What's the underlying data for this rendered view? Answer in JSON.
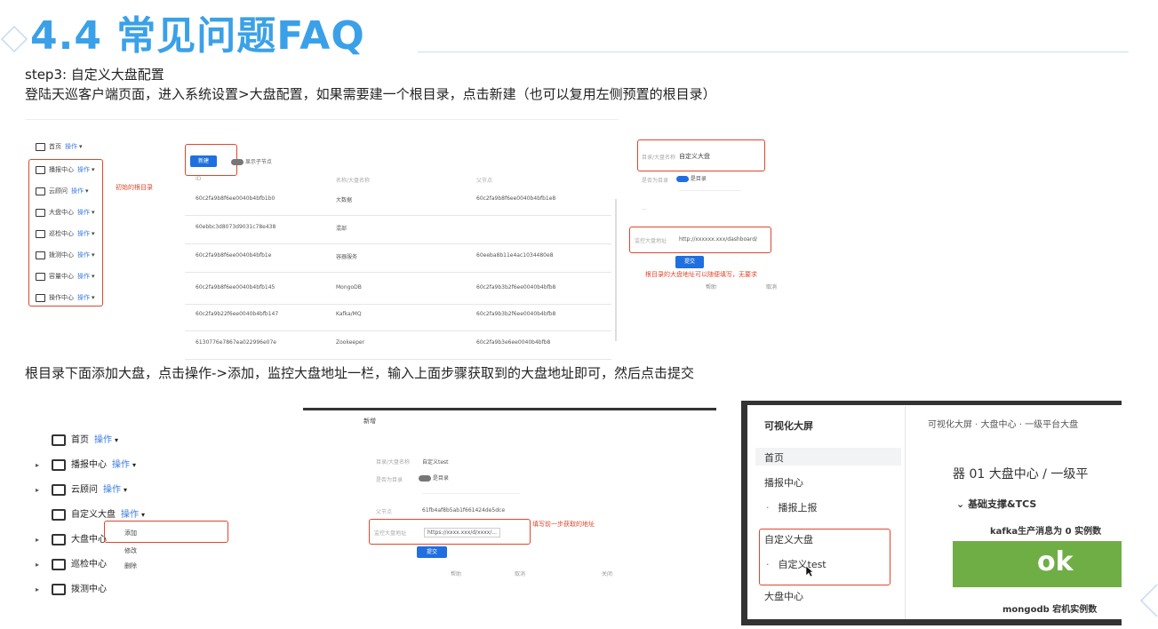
{
  "slide": {
    "title": "4.4 常见问题FAQ",
    "step_label": "step3: 自定义大盘配置",
    "desc1": "登陆天巡客户端页面，进入系统设置>大盘配置，如果需要建一个根目录，点击新建（也可以复用左侧预置的根目录）",
    "desc2": "根目录下面添加大盘，点击操作->添加，监控大盘地址一栏，输入上面步骤获取到的大盘地址即可，然后点击提交"
  },
  "colors": {
    "title": "#3aa1e8",
    "accent_blue": "#1f6fe0",
    "highlight_red": "#e0462c",
    "ok_green": "#6fae45"
  },
  "shot1": {
    "sidebar": [
      {
        "label": "首页",
        "op": "操作"
      },
      {
        "label": "播报中心",
        "op": "操作"
      },
      {
        "label": "云顾问",
        "op": "操作"
      },
      {
        "label": "大盘中心",
        "op": "操作"
      },
      {
        "label": "巡检中心",
        "op": "操作"
      },
      {
        "label": "拨测中心",
        "op": "操作"
      },
      {
        "label": "容量中心",
        "op": "操作"
      },
      {
        "label": "操作中心",
        "op": "操作"
      }
    ],
    "note": "初始的根目录",
    "new_button": "新建",
    "toggle_label": "显示子节点",
    "headers": [
      "ID",
      "名称/大盘名称",
      "父节点"
    ],
    "rows": [
      {
        "id": "60c2fa9b8f6ee0040b4bfb1b0",
        "name": "大数据",
        "parent": "60c2fa9b8f6ee0040b4bfb1e8"
      },
      {
        "id": "60ebbc3d8073d9031c78e438",
        "name": "混部",
        "parent": ""
      },
      {
        "id": "60c2fa9b8f6ee0040b4bfb1e",
        "name": "容器服务",
        "parent": "60eeba8b11e4ac1034480e8"
      },
      {
        "id": "60c2fa9b8f6ee0040b4bfb145",
        "name": "MongoDB",
        "parent": "60c2fa9b3b2f6ee0040b4bfb8"
      },
      {
        "id": "60c2fa9b22f6ee0040b4bfb147",
        "name": "Kafka/MQ",
        "parent": "60c2fa9b3b2f6ee0040b4bfb8"
      },
      {
        "id": "6130776e7867ea022996e07e",
        "name": "Zookeeper",
        "parent": "60c2fa9b3e6ee0040b4bfb8"
      }
    ]
  },
  "shot2": {
    "name_label": "目录/大盘名称",
    "name_value": "自定义大盘",
    "dir_label": "是否为目录",
    "toggle_label": "是目录",
    "url_label": "监控大盘地址",
    "url_value": "http://xxxxxx.xxx/dashboard/",
    "submit": "提交",
    "note": "根目录的大盘地址可以随便填写，无要求",
    "footer": [
      "帮助",
      "取消"
    ]
  },
  "shot3": {
    "sidebar": [
      {
        "label": "首页",
        "op": "操作",
        "expand": false
      },
      {
        "label": "播报中心",
        "op": "操作",
        "expand": true
      },
      {
        "label": "云顾问",
        "op": "操作",
        "expand": true
      },
      {
        "label": "自定义大盘",
        "op": "操作",
        "expand": false
      },
      {
        "label": "大盘中心",
        "op": "",
        "expand": true
      },
      {
        "label": "巡检中心",
        "op": "",
        "expand": true
      },
      {
        "label": "拨测中心",
        "op": "",
        "expand": true
      }
    ],
    "menu": [
      "添加",
      "修改",
      "删除"
    ]
  },
  "shot4": {
    "header": "新增",
    "name_label": "目录/大盘名称",
    "name_value": "自定义test",
    "dir_label": "是否为目录",
    "toggle_label": "是目录",
    "parent_label": "父节点",
    "parent_value": "61fb4af8b5ab1f661424de5dce",
    "url_label": "监控大盘地址",
    "url_value": "https://xxxx.xxx/d/xxxx/...",
    "submit": "提交",
    "note": "填写前一步获取的地址",
    "footer": [
      "帮助",
      "取消",
      "关闭"
    ]
  },
  "shot5": {
    "app_title": "可视化大屏",
    "breadcrumb": "可视化大屏 · 大盘中心 · 一级平台大盘",
    "nav": [
      {
        "label": "首页",
        "level": 0
      },
      {
        "label": "播报中心",
        "level": 0
      },
      {
        "label": "播报上报",
        "level": 1
      },
      {
        "label": "自定义大盘",
        "level": 0
      },
      {
        "label": "自定义test",
        "level": 1
      },
      {
        "label": "大盘中心",
        "level": 0
      }
    ],
    "page_heading": "器 01 大盘中心 / 一级平",
    "section": "基础支撑&TCS",
    "metric1": "kafka生产消息为 0 实例数",
    "ok_text": "ok",
    "metric2": "mongodb 宕机实例数"
  }
}
